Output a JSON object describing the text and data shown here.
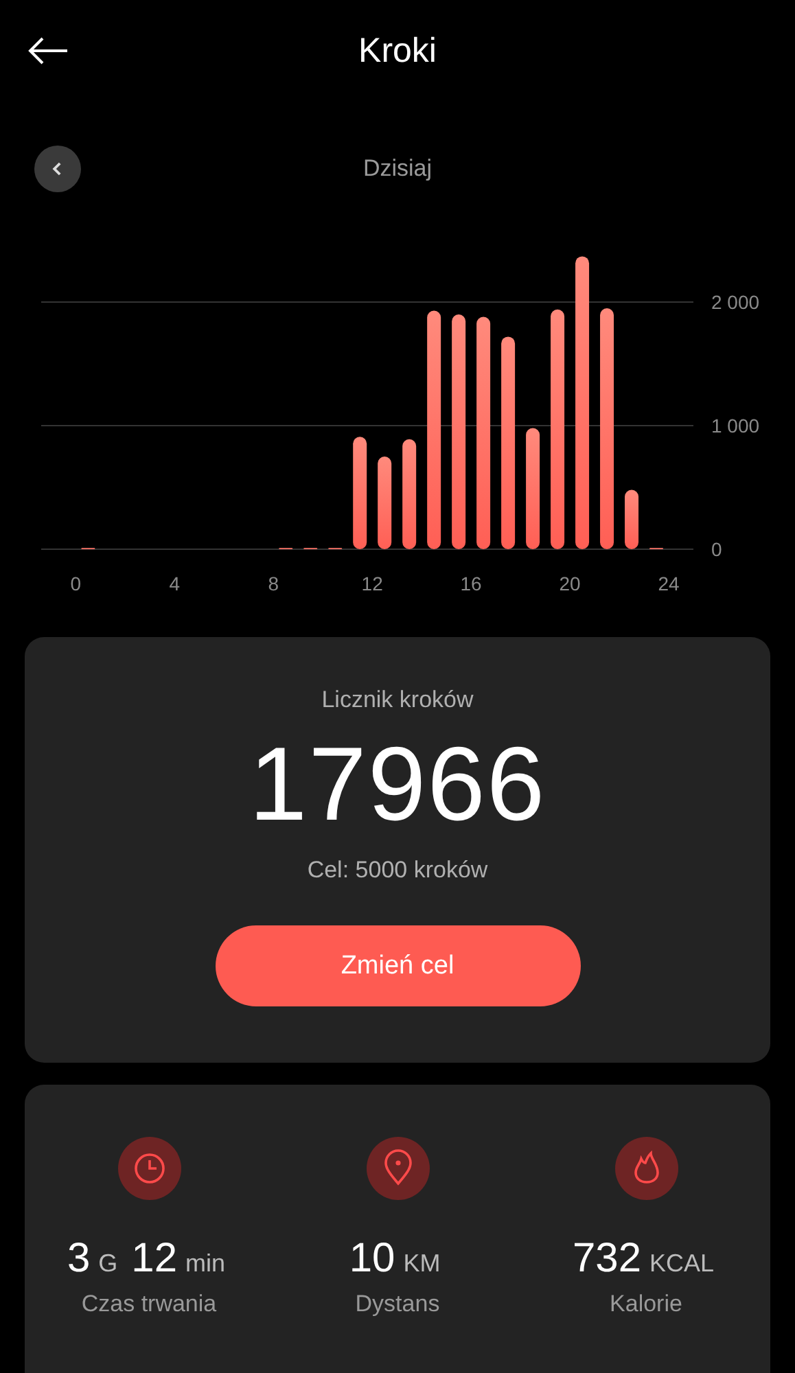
{
  "header": {
    "title": "Kroki"
  },
  "period": {
    "label": "Dzisiaj"
  },
  "chart": {
    "chart_data": {
      "type": "bar",
      "x": [
        0.5,
        1.5,
        2.5,
        3.5,
        4.5,
        5.5,
        6.5,
        7.5,
        8.5,
        9.5,
        10.5,
        11.5,
        12.5,
        13.5,
        14.5,
        15.5,
        16.5,
        17.5,
        18.5,
        19.5,
        20.5,
        21.5,
        22.5,
        23.5
      ],
      "values": [
        10,
        0,
        0,
        0,
        0,
        0,
        0,
        0,
        10,
        10,
        10,
        910,
        750,
        890,
        1930,
        1900,
        1880,
        1720,
        980,
        1940,
        2370,
        1950,
        480,
        10
      ],
      "xlim": [
        -1.4,
        25
      ],
      "ylim": [
        0,
        2400
      ],
      "xticks": [
        0,
        4,
        8,
        12,
        16,
        20,
        24
      ],
      "yticks": [
        0,
        {
          "value": 1000,
          "label": "1 000"
        },
        {
          "value": 2000,
          "label": "2 000"
        }
      ]
    }
  },
  "counter": {
    "title": "Licznik kroków",
    "value": "17966",
    "goal": "Cel: 5000 kroków",
    "button": "Zmień cel"
  },
  "stats": [
    {
      "parts": [
        {
          "number": "3",
          "unit": "G"
        },
        {
          "number": "12",
          "unit": "min"
        }
      ],
      "label": "Czas trwania"
    },
    {
      "parts": [
        {
          "number": "10",
          "unit": "KM"
        }
      ],
      "label": "Dystans"
    },
    {
      "parts": [
        {
          "number": "732",
          "unit": "KCAL"
        }
      ],
      "label": "Kalorie"
    }
  ]
}
